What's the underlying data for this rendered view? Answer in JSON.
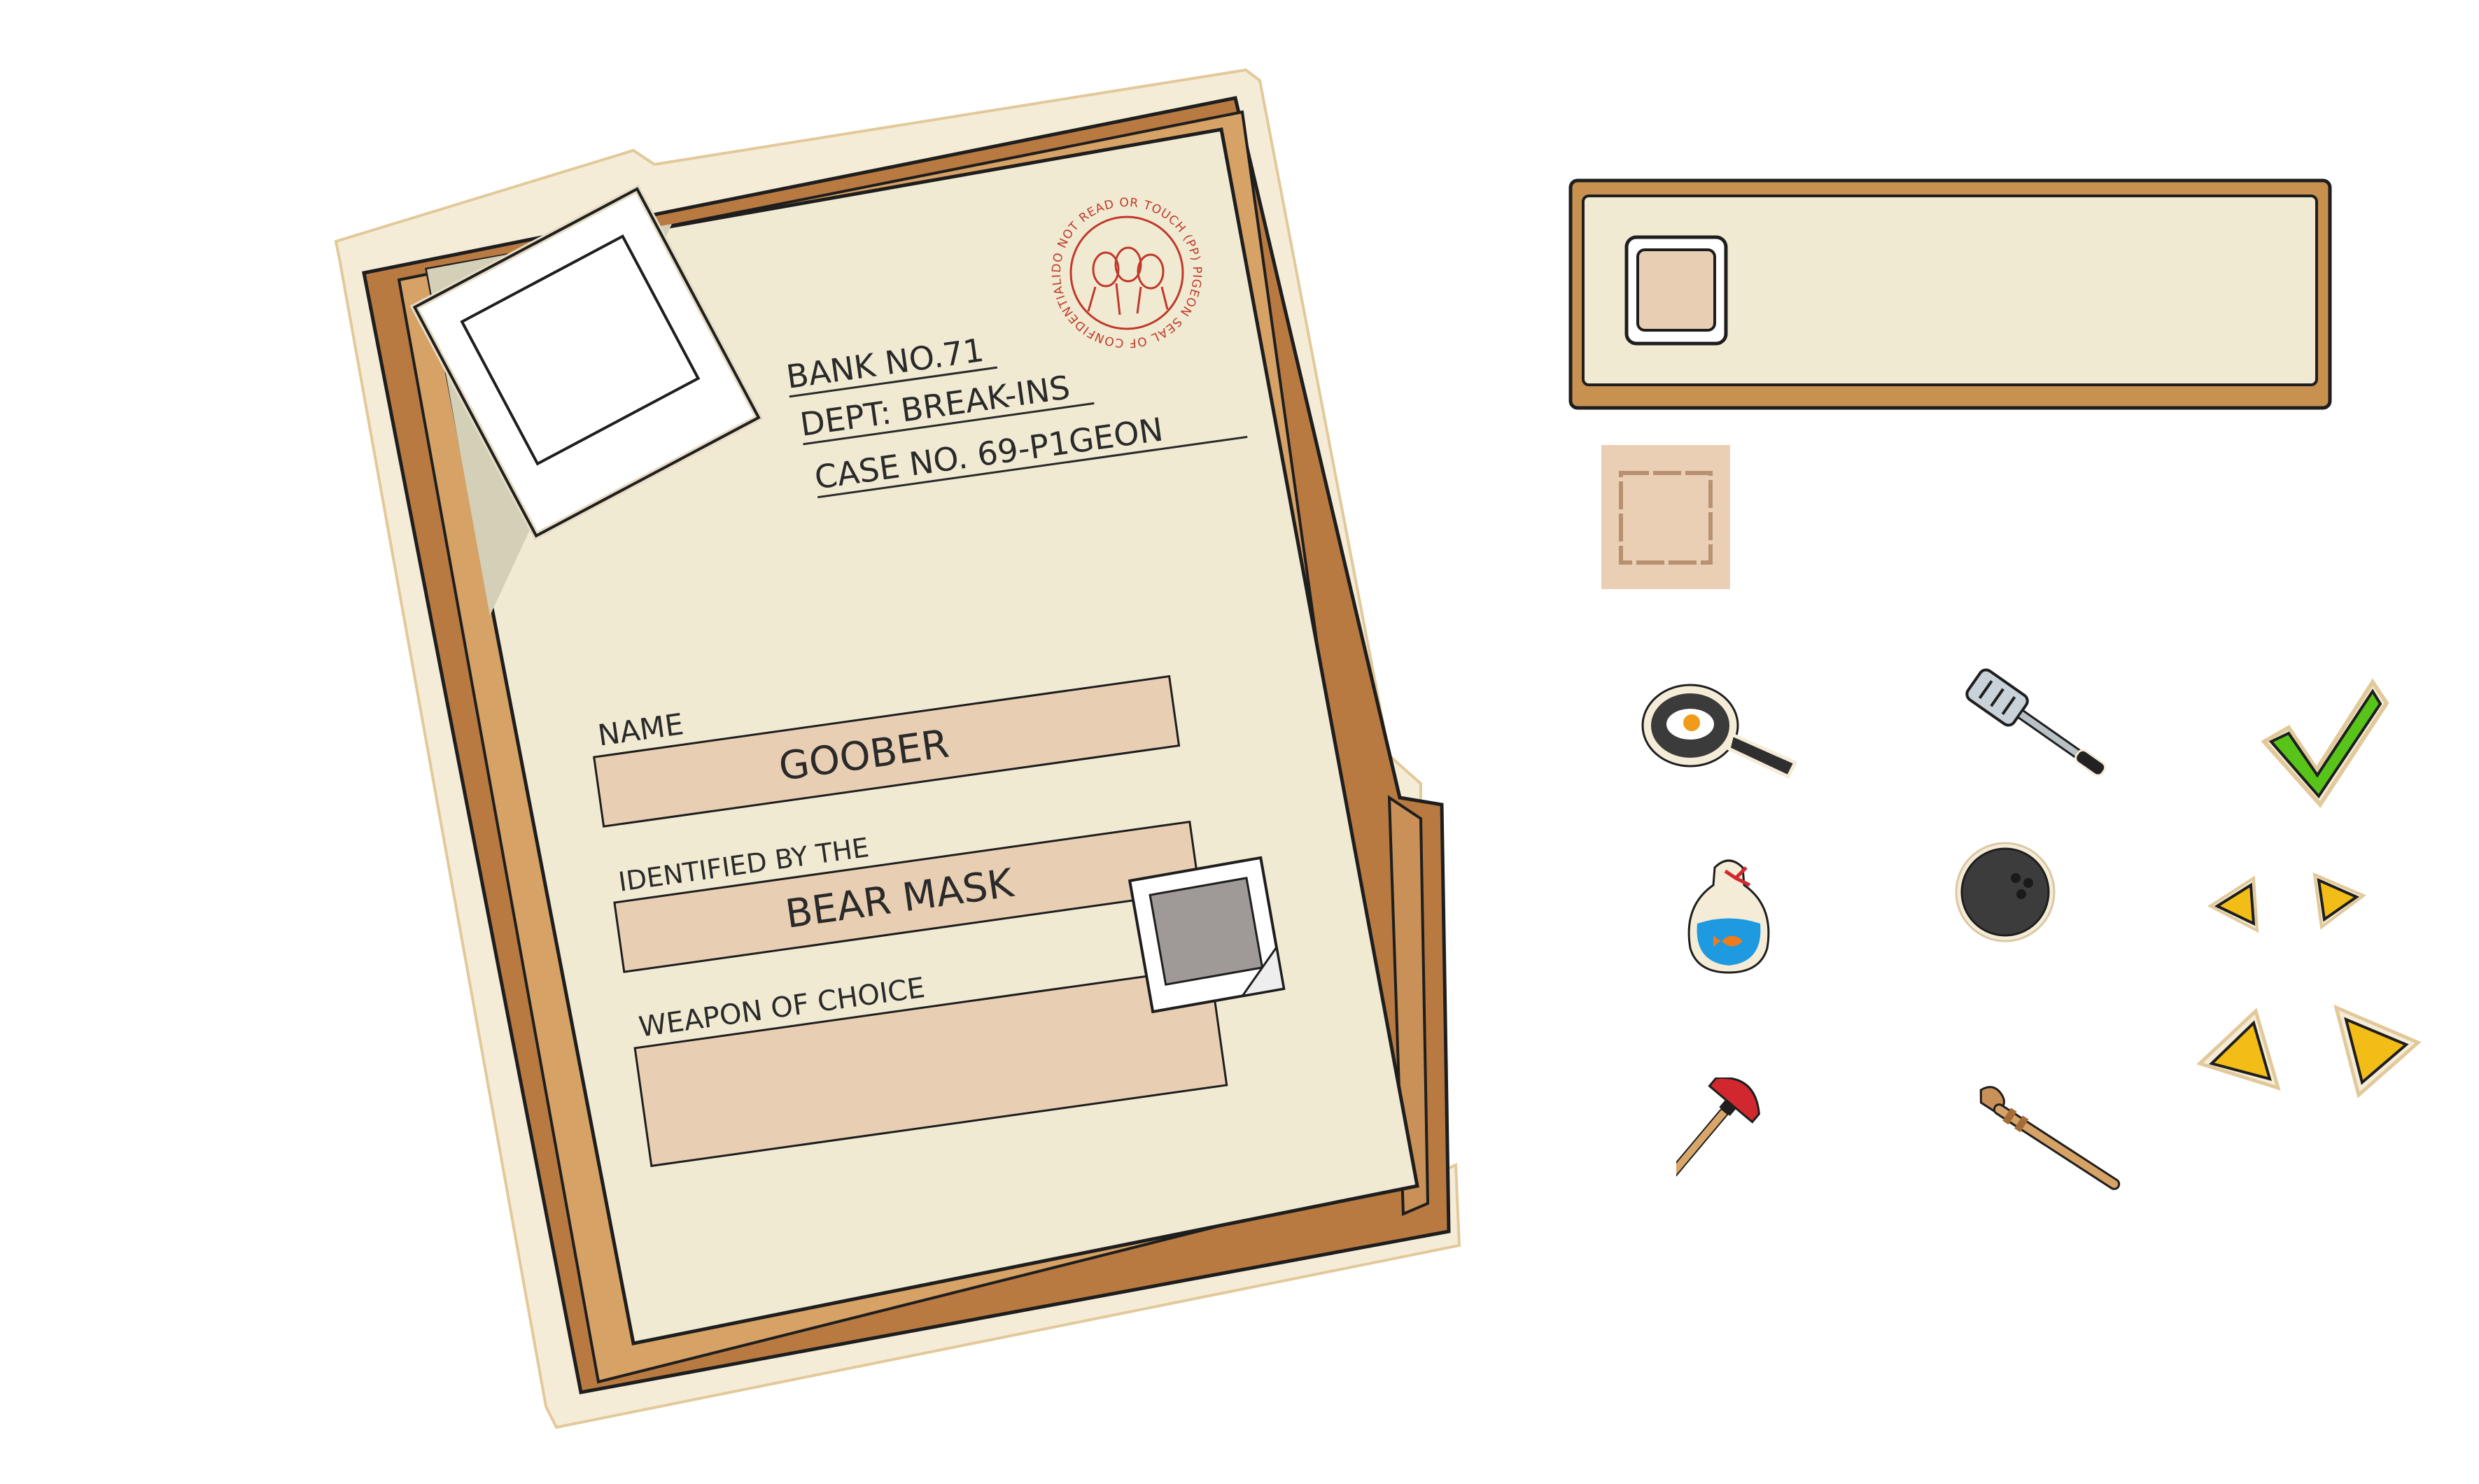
{
  "case_file": {
    "bank": "BANK NO.71",
    "dept": "DEPT: BREAK-INS",
    "case_no": "CASE NO. 69-P1GEON",
    "seal_text": "DO NOT READ OR TOUCH (PP) PIGEON SEAL OF CONFIDENTIALITY.",
    "name_label": "NAME",
    "name_value": "GOOBER",
    "identified_label": "IDENTIFIED BY THE",
    "identified_value": "BEAR MASK",
    "weapon_label": "WEAPON OF CHOICE",
    "weapon_value": ""
  },
  "inventory": {
    "items": [
      {
        "id": "frying-pan",
        "icon": "frying-pan-icon"
      },
      {
        "id": "spatula",
        "icon": "spatula-icon"
      },
      {
        "id": "goldfish-bag",
        "icon": "goldfish-bag-icon"
      },
      {
        "id": "bowling-ball",
        "icon": "bowling-ball-icon"
      },
      {
        "id": "plunger",
        "icon": "plunger-icon"
      },
      {
        "id": "wooden-staff",
        "icon": "wooden-staff-icon"
      }
    ]
  },
  "controls": {
    "confirm_icon": "checkmark-icon",
    "arrow_icons": [
      "arrow-left-small-icon",
      "arrow-right-small-icon",
      "arrow-left-large-icon",
      "arrow-right-large-icon"
    ]
  },
  "colors": {
    "paper": "#f1ead3",
    "folder": "#c99157",
    "folder_dark": "#a56b37",
    "field": "#e8cfb3",
    "stamp": "#c0392b",
    "check": "#58c41a",
    "arrow": "#f2bd17"
  }
}
